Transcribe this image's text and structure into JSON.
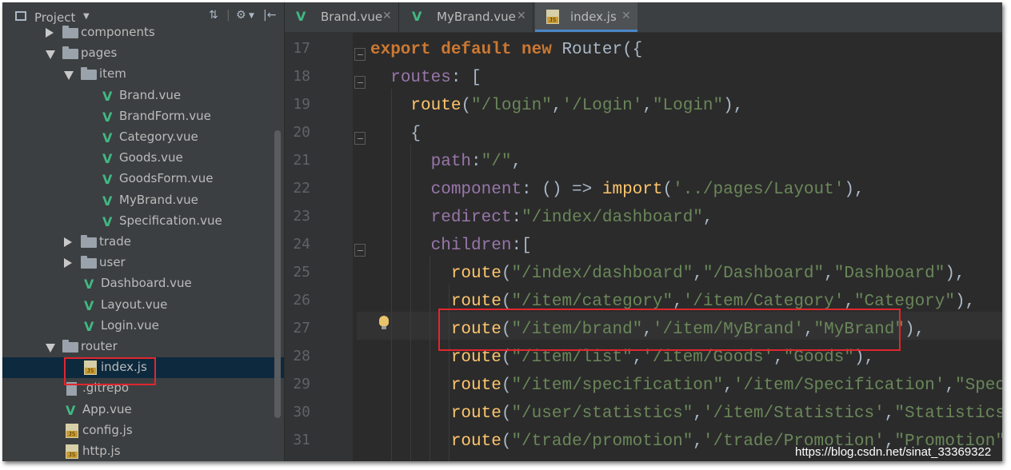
{
  "project": {
    "title": "Project",
    "tree": [
      {
        "label": "components",
        "type": "folder",
        "depth": 2,
        "state": "collapsed"
      },
      {
        "label": "pages",
        "type": "folder",
        "depth": 2,
        "state": "expanded"
      },
      {
        "label": "item",
        "type": "folder",
        "depth": 3,
        "state": "expanded"
      },
      {
        "label": "Brand.vue",
        "type": "vue",
        "depth": 4
      },
      {
        "label": "BrandForm.vue",
        "type": "vue",
        "depth": 4
      },
      {
        "label": "Category.vue",
        "type": "vue",
        "depth": 4
      },
      {
        "label": "Goods.vue",
        "type": "vue",
        "depth": 4
      },
      {
        "label": "GoodsForm.vue",
        "type": "vue",
        "depth": 4
      },
      {
        "label": "MyBrand.vue",
        "type": "vue",
        "depth": 4
      },
      {
        "label": "Specification.vue",
        "type": "vue",
        "depth": 4
      },
      {
        "label": "trade",
        "type": "folder",
        "depth": 3,
        "state": "collapsed"
      },
      {
        "label": "user",
        "type": "folder",
        "depth": 3,
        "state": "collapsed"
      },
      {
        "label": "Dashboard.vue",
        "type": "vue",
        "depth": 3
      },
      {
        "label": "Layout.vue",
        "type": "vue",
        "depth": 3
      },
      {
        "label": "Login.vue",
        "type": "vue",
        "depth": 3
      },
      {
        "label": "router",
        "type": "folder",
        "depth": 2,
        "state": "expanded"
      },
      {
        "label": "index.js",
        "type": "js",
        "depth": 3,
        "selected": true
      },
      {
        "label": ".gitrepo",
        "type": "file",
        "depth": 2
      },
      {
        "label": "App.vue",
        "type": "vue",
        "depth": 2
      },
      {
        "label": "config.js",
        "type": "js",
        "depth": 2
      },
      {
        "label": "http.js",
        "type": "js",
        "depth": 2
      }
    ]
  },
  "tabs": [
    {
      "label": "Brand.vue",
      "icon": "vue-icon",
      "active": false
    },
    {
      "label": "MyBrand.vue",
      "icon": "vue-icon",
      "active": false
    },
    {
      "label": "index.js",
      "icon": "js-icon",
      "active": true
    }
  ],
  "line_numbers": [
    "17",
    "18",
    "19",
    "20",
    "21",
    "22",
    "23",
    "24",
    "25",
    "26",
    "27",
    "28",
    "29",
    "30",
    "31"
  ],
  "code_lines": [
    [
      [
        "kw",
        "export default new "
      ],
      [
        "punc",
        "Router({"
      ]
    ],
    [
      [
        "punc",
        "  "
      ],
      [
        "prop",
        "routes"
      ],
      [
        "punc",
        ": ["
      ]
    ],
    [
      [
        "punc",
        "    "
      ],
      [
        "fn",
        "route"
      ],
      [
        "punc",
        "("
      ],
      [
        "str",
        "\"/login\""
      ],
      [
        "punc",
        ","
      ],
      [
        "str",
        "'/Login'"
      ],
      [
        "punc",
        ","
      ],
      [
        "str",
        "\"Login\""
      ],
      [
        "punc",
        "),"
      ]
    ],
    [
      [
        "punc",
        "    {"
      ]
    ],
    [
      [
        "punc",
        "      "
      ],
      [
        "prop",
        "path"
      ],
      [
        "punc",
        ":"
      ],
      [
        "str",
        "\"/\""
      ],
      [
        "punc",
        ","
      ]
    ],
    [
      [
        "punc",
        "      "
      ],
      [
        "prop",
        "component"
      ],
      [
        "punc",
        ": () => "
      ],
      [
        "fn",
        "import"
      ],
      [
        "punc",
        "("
      ],
      [
        "str",
        "'../pages/Layout'"
      ],
      [
        "punc",
        "),"
      ]
    ],
    [
      [
        "punc",
        "      "
      ],
      [
        "prop",
        "redirect"
      ],
      [
        "punc",
        ":"
      ],
      [
        "str",
        "\"/index/dashboard\""
      ],
      [
        "punc",
        ","
      ]
    ],
    [
      [
        "punc",
        "      "
      ],
      [
        "prop",
        "children"
      ],
      [
        "punc",
        ":["
      ]
    ],
    [
      [
        "punc",
        "        "
      ],
      [
        "fn",
        "route"
      ],
      [
        "punc",
        "("
      ],
      [
        "str",
        "\"/index/dashboard\""
      ],
      [
        "punc",
        ","
      ],
      [
        "str",
        "\"/Dashboard\""
      ],
      [
        "punc",
        ","
      ],
      [
        "str",
        "\"Dashboard\""
      ],
      [
        "punc",
        "),"
      ]
    ],
    [
      [
        "punc",
        "        "
      ],
      [
        "fn",
        "route"
      ],
      [
        "punc",
        "("
      ],
      [
        "str",
        "\"/item/category\""
      ],
      [
        "punc",
        ","
      ],
      [
        "str",
        "'/item/Category'"
      ],
      [
        "punc",
        ","
      ],
      [
        "str",
        "\"Category\""
      ],
      [
        "punc",
        "),"
      ]
    ],
    [
      [
        "punc",
        "        "
      ],
      [
        "fn",
        "route"
      ],
      [
        "punc",
        "("
      ],
      [
        "str",
        "\"/item/brand\""
      ],
      [
        "punc",
        ","
      ],
      [
        "str",
        "'/item/MyBrand'"
      ],
      [
        "punc",
        ","
      ],
      [
        "str",
        "\"MyBrand\""
      ],
      [
        "punc",
        "),"
      ]
    ],
    [
      [
        "punc",
        "        "
      ],
      [
        "fn",
        "route"
      ],
      [
        "punc",
        "("
      ],
      [
        "str",
        "\"/item/list\""
      ],
      [
        "punc",
        ","
      ],
      [
        "str",
        "'/item/Goods'"
      ],
      [
        "punc",
        ","
      ],
      [
        "str",
        "\"Goods\""
      ],
      [
        "punc",
        "),"
      ]
    ],
    [
      [
        "punc",
        "        "
      ],
      [
        "fn",
        "route"
      ],
      [
        "punc",
        "("
      ],
      [
        "str",
        "\"/item/specification\""
      ],
      [
        "punc",
        ","
      ],
      [
        "str",
        "'/item/Specification'"
      ],
      [
        "punc",
        ","
      ],
      [
        "str",
        "\"Specifi"
      ]
    ],
    [
      [
        "punc",
        "        "
      ],
      [
        "fn",
        "route"
      ],
      [
        "punc",
        "("
      ],
      [
        "str",
        "\"/user/statistics\""
      ],
      [
        "punc",
        ","
      ],
      [
        "str",
        "'/item/Statistics'"
      ],
      [
        "punc",
        ","
      ],
      [
        "str",
        "\"Statistics\""
      ],
      [
        "punc",
        "),"
      ]
    ],
    [
      [
        "punc",
        "        "
      ],
      [
        "fn",
        "route"
      ],
      [
        "punc",
        "("
      ],
      [
        "str",
        "\"/trade/promotion\""
      ],
      [
        "punc",
        ","
      ],
      [
        "str",
        "'/trade/Promotion'"
      ],
      [
        "punc",
        ","
      ],
      [
        "str",
        "\"Promotion\""
      ],
      [
        "punc",
        ")"
      ]
    ]
  ],
  "watermark": "https://blog.csdn.net/sinat_33369322"
}
